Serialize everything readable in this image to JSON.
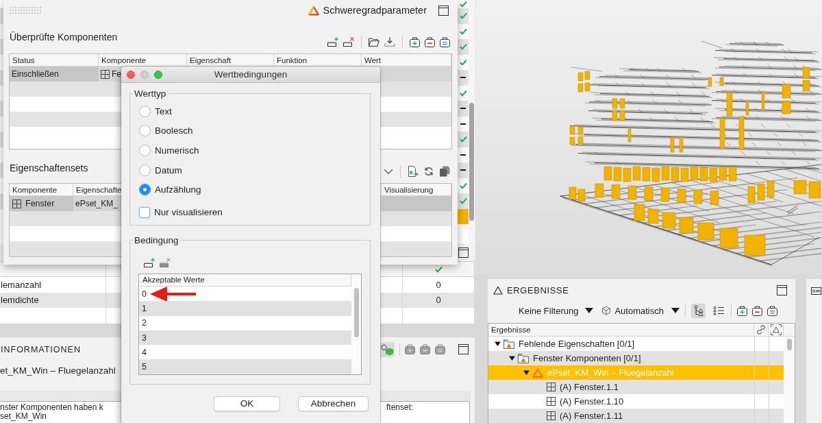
{
  "severity_window": {
    "title": "Schweregradparameter",
    "checked_components": {
      "title": "Überprüfte Komponenten",
      "row_actions": [
        {
          "kind": "add",
          "disabled": false
        },
        {
          "kind": "remove",
          "disabled": false
        }
      ],
      "actions": [
        {
          "kind": "add",
          "disabled": false
        },
        {
          "kind": "remove",
          "disabled": false
        },
        {
          "kind": "assign",
          "disabled": false
        }
      ],
      "columns": [
        "Status",
        "Komponente",
        "Eigenschaft",
        "Funktion",
        "Wert"
      ],
      "rows": [
        {
          "status": "Einschließen",
          "component": "Fe",
          "selected": true
        }
      ]
    },
    "property_sets": {
      "title": "Eigenschaftensets",
      "columns": [
        "Komponente",
        "Eigenschafte",
        "Visualisierung"
      ],
      "rows": [
        {
          "component": "Fenster",
          "property_set": "ePset_KM_",
          "selected": true
        }
      ]
    }
  },
  "dialog": {
    "title": "Wertbedingungen",
    "value_type": {
      "legend": "Werttyp",
      "options": [
        {
          "label": "Text",
          "selected": false
        },
        {
          "label": "Boolesch",
          "selected": false
        },
        {
          "label": "Numerisch",
          "selected": false
        },
        {
          "label": "Datum",
          "selected": false
        },
        {
          "label": "Aufzählung",
          "selected": true
        }
      ],
      "visualize_only": {
        "label": "Nur visualisieren",
        "checked": false
      }
    },
    "condition": {
      "legend": "Bedingung",
      "row_actions": [
        {
          "kind": "add",
          "disabled": false
        },
        {
          "kind": "remove",
          "disabled": true
        }
      ],
      "column": "Akzeptable Werte",
      "values": [
        {
          "label": "0",
          "selected": false,
          "marked": true
        },
        {
          "label": "1",
          "selected": false,
          "marked": false
        },
        {
          "label": "2",
          "selected": false,
          "marked": false
        },
        {
          "label": "3",
          "selected": false,
          "marked": false
        },
        {
          "label": "4",
          "selected": false,
          "marked": false
        },
        {
          "label": "5",
          "selected": false,
          "marked": false
        }
      ]
    },
    "buttons": [
      "OK",
      "Abbrechen"
    ]
  },
  "background_table": {
    "rows": [
      {
        "kind": "passed",
        "selected": false
      },
      {
        "kind": "passed",
        "selected": false
      },
      {
        "kind": "passed",
        "selected": false
      },
      {
        "kind": "passed",
        "selected": false
      },
      {
        "kind": "passed",
        "selected": false
      },
      {
        "kind": "open",
        "selected": false
      },
      {
        "kind": "passed",
        "selected": false
      },
      {
        "kind": "open",
        "selected": false
      },
      {
        "kind": "open",
        "selected": false
      },
      {
        "kind": "passed",
        "selected": false
      },
      {
        "kind": "open",
        "selected": false
      },
      {
        "kind": "open",
        "selected": false
      },
      {
        "kind": "passed",
        "selected": false
      },
      {
        "kind": "passed",
        "selected": false
      },
      {
        "kind": "blank",
        "selected": true
      }
    ]
  },
  "lower_table": {
    "rows": [
      {
        "name": "lemanzahl",
        "value": "0"
      },
      {
        "name": "lemdichte",
        "value": "0"
      }
    ]
  },
  "info_panel": {
    "title": "INFORMATIONEN",
    "model_toggle": {
      "on": true
    },
    "actions": [
      {
        "kind": "add",
        "disabled": true
      },
      {
        "kind": "remove",
        "disabled": true
      },
      {
        "kind": "assign",
        "disabled": true
      }
    ],
    "subtitle": "et_KM_Win – Fluegelanzahl",
    "message": {
      "line_1_left": "nster Komponenten haben k",
      "line_1_right": "ftenset:",
      "line_2": "set_KM_Win"
    }
  },
  "results_panel": {
    "title": "ERGEBNISSE",
    "filter": "Keine Filterung",
    "mode": "Automatisch",
    "view_modes": [
      {
        "kind": "tree",
        "selected": true
      },
      {
        "kind": "list",
        "selected": false
      }
    ],
    "actions": [
      {
        "kind": "add",
        "disabled": false
      },
      {
        "kind": "remove",
        "disabled": false
      },
      {
        "kind": "assign",
        "disabled": false
      }
    ],
    "column": "Ergebnisse",
    "tree": [
      {
        "label": "Fehlende Eigenschaften [0/1]",
        "kind": "group",
        "expanded": true,
        "selected": false,
        "children": [
          {
            "label": "Fenster Komponenten [0/1]",
            "kind": "group",
            "expanded": true,
            "selected": false,
            "children": [
              {
                "label": "ePset_KM_Win – Fluegelanzahl",
                "kind": "issue",
                "expanded": true,
                "selected": true,
                "children": [
                  {
                    "label": "(A) Fenster.1.1",
                    "kind": "component",
                    "selected": false
                  },
                  {
                    "label": "(A) Fenster.1.10",
                    "kind": "component",
                    "selected": false
                  },
                  {
                    "label": "(A) Fenster.1.11",
                    "kind": "component",
                    "selected": false
                  }
                ]
              }
            ]
          }
        ]
      }
    ]
  }
}
